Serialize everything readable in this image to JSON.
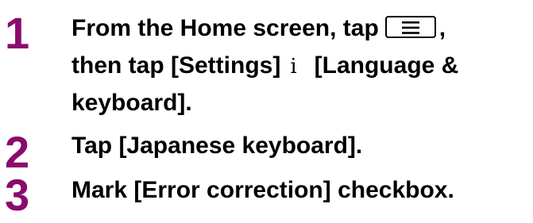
{
  "steps": [
    {
      "number": "1",
      "line1_prefix": "From the Home screen, tap",
      "menu_icon": "menu-key-icon",
      "line1_suffix": ",",
      "line2_prefix": "then tap [Settings]",
      "separator": "i",
      "line2_suffix": "[Language &",
      "line3": "keyboard]."
    },
    {
      "number": "2",
      "text": "Tap [Japanese keyboard]."
    },
    {
      "number": "3",
      "text": "Mark [Error correction] checkbox."
    }
  ],
  "colors": {
    "step_number": "#8a0a6e",
    "text": "#000000"
  }
}
